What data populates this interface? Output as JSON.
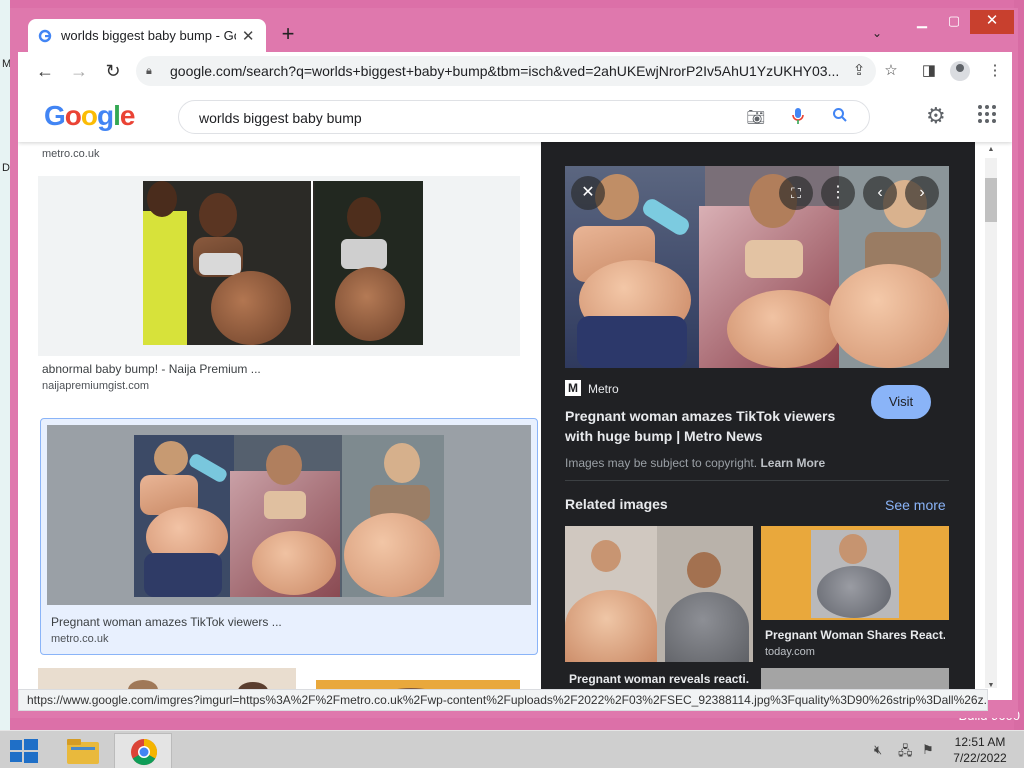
{
  "desktop": {
    "build_text": "Build 9600",
    "letter_m": "M",
    "letter_d": "D"
  },
  "browser": {
    "tab_title": "worlds biggest baby bump - Goo",
    "url": "google.com/search?q=worlds+biggest+baby+bump&tbm=isch&ved=2ahUKEwjNrorP2Iv5AhU1YzUKHY03...",
    "status_url": "https://www.google.com/imgres?imgurl=https%3A%2F%2Fmetro.co.uk%2Fwp-content%2Fuploads%2F2022%2F03%2FSEC_92388114.jpg%3Fquality%3D90%26strip%3Dall%26z..."
  },
  "google": {
    "logo_letters": [
      "G",
      "o",
      "o",
      "g",
      "l",
      "e"
    ],
    "query": "worlds biggest baby bump"
  },
  "results": {
    "top_source": "metro.co.uk",
    "cards": [
      {
        "caption": "abnormal baby bump! - Naija Premium ...",
        "source": "naijapremiumgist.com"
      },
      {
        "caption": "Pregnant woman amazes TikTok viewers ...",
        "source": "metro.co.uk"
      }
    ]
  },
  "preview": {
    "site_logo": "M",
    "site_name": "Metro",
    "title": "Pregnant woman amazes TikTok viewers with huge bump | Metro News",
    "visit_label": "Visit",
    "copyright_text": "Images may be subject to copyright.",
    "learn_more": "Learn More",
    "related_heading": "Related images",
    "see_more": "See more",
    "related": [
      {
        "caption": "Pregnant woman reveals reacti...",
        "source": ""
      },
      {
        "caption": "Pregnant Woman Shares React...",
        "source": "today.com"
      }
    ]
  },
  "taskbar": {
    "time": "12:51 AM",
    "date": "7/22/2022"
  },
  "colors": {
    "accent": "#8ab4f8",
    "desktop": "#dc70a8",
    "preview_bg": "#202124"
  }
}
